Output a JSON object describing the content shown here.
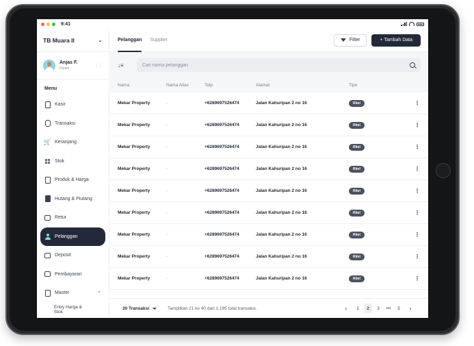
{
  "status": {
    "time": "9:41",
    "dot_colors": [
      "#ff5f57",
      "#febc2e",
      "#28c840"
    ]
  },
  "sidebar": {
    "store": "TB Muara II",
    "user": {
      "name": "Anjas F.",
      "role": "Owner"
    },
    "menu_title": "Menu",
    "items": [
      {
        "label": "Kasir",
        "icon": "document-icon"
      },
      {
        "label": "Transaksi",
        "icon": "receipt-icon"
      },
      {
        "label": "Keranjang",
        "icon": "cart-icon"
      },
      {
        "label": "Stok",
        "icon": "grid-icon"
      },
      {
        "label": "Produk & Harga",
        "icon": "document-icon"
      },
      {
        "label": "Hutang & Piutang",
        "icon": "file-icon"
      },
      {
        "label": "Retur",
        "icon": "wallet-icon"
      },
      {
        "label": "Pelanggan",
        "icon": "person-icon",
        "active": true
      },
      {
        "label": "Deposit",
        "icon": "wallet-icon"
      },
      {
        "label": "Pembayaran",
        "icon": "wallet-icon"
      },
      {
        "label": "Master",
        "icon": "document-icon",
        "expanded": true
      }
    ],
    "sub_items": [
      "Entry Harga & Stok"
    ]
  },
  "header": {
    "tabs": [
      {
        "label": "Pelanggan",
        "active": true
      },
      {
        "label": "Supplier",
        "active": false
      }
    ],
    "filter_label": "Filter",
    "add_label": "+ Tambah Data"
  },
  "search": {
    "placeholder": "Cari nama pelanggan",
    "value": ""
  },
  "table": {
    "columns": [
      "Nama",
      "Nama Alias",
      "Telp",
      "Alamat",
      "Tipe"
    ],
    "rows": [
      {
        "nama": "Mekar Property",
        "alias": "-",
        "telp": "+6289697526474",
        "alamat": "Jalan Kahuripan 2 no 16",
        "tipe": "Ritel"
      },
      {
        "nama": "Mekar Property",
        "alias": "-",
        "telp": "+6289697526474",
        "alamat": "Jalan Kahuripan 2 no 16",
        "tipe": "Ritel"
      },
      {
        "nama": "Mekar Property",
        "alias": "-",
        "telp": "+6289697526474",
        "alamat": "Jalan Kahuripan 2 no 16",
        "tipe": "Ritel"
      },
      {
        "nama": "Mekar Property",
        "alias": "-",
        "telp": "+6289697526474",
        "alamat": "Jalan Kahuripan 2 no 16",
        "tipe": "Ritel"
      },
      {
        "nama": "Mekar Property",
        "alias": "-",
        "telp": "+6289697526474",
        "alamat": "Jalan Kahuripan 2 no 16",
        "tipe": "Ritel"
      },
      {
        "nama": "Mekar Property",
        "alias": "-",
        "telp": "+6289697526474",
        "alamat": "Jalan Kahuripan 2 no 16",
        "tipe": "Ritel"
      },
      {
        "nama": "Mekar Property",
        "alias": "-",
        "telp": "+6289697526474",
        "alamat": "Jalan Kahuripan 2 no 16",
        "tipe": "Ritel"
      },
      {
        "nama": "Mekar Property",
        "alias": "-",
        "telp": "+6289697526474",
        "alamat": "Jalan Kahuripan 2 no 16",
        "tipe": "Ritel"
      },
      {
        "nama": "Mekar Property",
        "alias": "-",
        "telp": "+6289697526474",
        "alamat": "Jalan Kahuripan 2 no 16",
        "tipe": "Ritel"
      }
    ]
  },
  "footer": {
    "per_page": "20 Transaksi",
    "info": "Tampilkan 21 ke 40 dari 1.195 total transaksi.",
    "pages": [
      "1",
      "2",
      "3",
      "•••",
      "5"
    ],
    "current_page": "2"
  },
  "colors": {
    "primary": "#23293a",
    "accent": "#7ee0d0",
    "badge": "#4d5260"
  }
}
